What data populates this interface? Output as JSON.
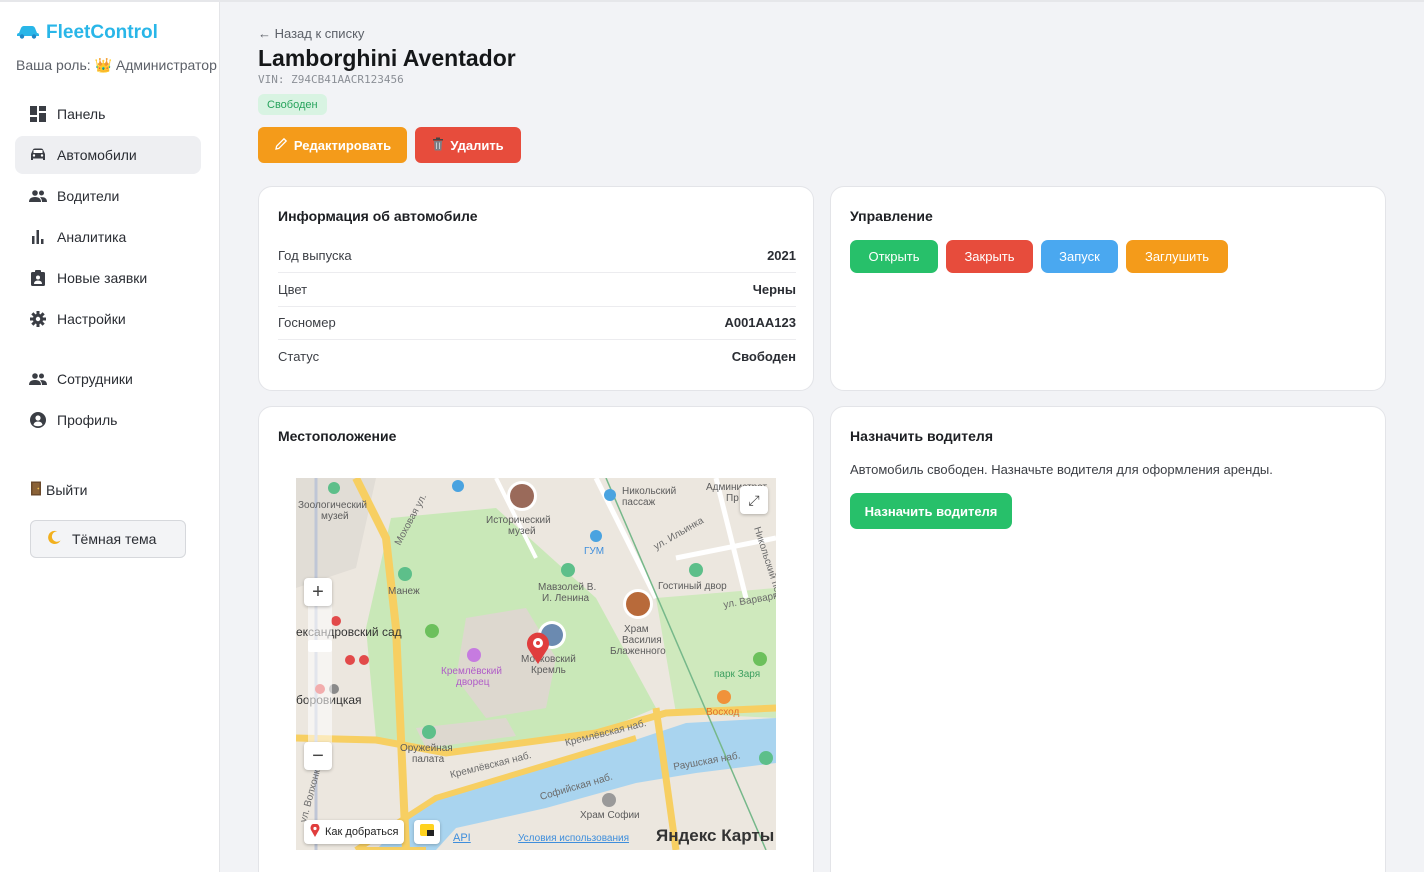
{
  "app": {
    "brand": "FleetControl",
    "role_label": "Ваша роль: 👑 Администратор"
  },
  "sidebar": {
    "items": [
      {
        "label": "Панель",
        "icon": "dashboard-icon"
      },
      {
        "label": "Автомобили",
        "icon": "car-icon",
        "active": true
      },
      {
        "label": "Водители",
        "icon": "people-icon"
      },
      {
        "label": "Аналитика",
        "icon": "bar-chart-icon"
      },
      {
        "label": "Новые заявки",
        "icon": "clipboard-icon"
      },
      {
        "label": "Настройки",
        "icon": "gear-icon"
      },
      {
        "label": "Сотрудники",
        "icon": "people-icon"
      },
      {
        "label": "Профиль",
        "icon": "user-circle-icon"
      }
    ],
    "logout": "Выйти",
    "theme_toggle": "Тёмная тема"
  },
  "header": {
    "back": "← Назад к списку",
    "title": "Lamborghini Aventador",
    "vin": "VIN: Z94CB41AACR123456",
    "status": "Свободен",
    "edit_label": "Редактировать",
    "delete_label": "Удалить"
  },
  "info": {
    "title": "Информация об автомобиле",
    "rows": [
      {
        "key": "Год выпуска",
        "value": "2021"
      },
      {
        "key": "Цвет",
        "value": "Черны"
      },
      {
        "key": "Госномер",
        "value": "А001АА123"
      },
      {
        "key": "Статус",
        "value": "Свободен"
      }
    ]
  },
  "control": {
    "title": "Управление",
    "buttons": [
      {
        "label": "Открыть",
        "color": "#27c06a"
      },
      {
        "label": "Закрыть",
        "color": "#e74c3c"
      },
      {
        "label": "Запуск",
        "color": "#4aa8f0"
      },
      {
        "label": "Заглушить",
        "color": "#f49b1a"
      }
    ]
  },
  "location": {
    "title": "Местоположение",
    "map": {
      "route_label": "Как добраться",
      "api_label": "API",
      "terms_label": "Условия использования",
      "provider_label": "Яндекс Карты",
      "places": [
        "Зоологический музей",
        "Исторический музей",
        "Никольский пассаж",
        "ГУМ",
        "Манеж",
        "Мавзолей В. И. Ленина",
        "Гостиный двор",
        "Храм Василия Блаженного",
        "Кремлёвский дворец",
        "Московский Кремль",
        "Оружейная палата",
        "Храм Софии",
        "Восход",
        "парк Заря",
        "Административное пр",
        "Александровский сад",
        "Боровицкая"
      ],
      "streets": [
        "Моховая ул.",
        "ул. Ильинка",
        "Никольский пер.",
        "ул. Варварка",
        "Кремлёвская наб.",
        "Софийская наб.",
        "Раушская наб.",
        "ул. Волхонка"
      ]
    }
  },
  "assign": {
    "title": "Назначить водителя",
    "text": "Автомобиль свободен. Назначьте водителя для оформления аренды.",
    "button": "Назначить водителя"
  },
  "colors": {
    "brand": "#29b6e8",
    "status_free_bg": "#d8f3e2",
    "status_free_fg": "#27a35c"
  }
}
